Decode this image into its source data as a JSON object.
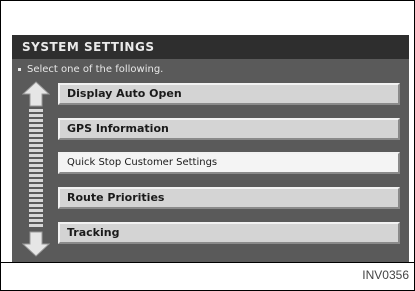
{
  "screen": {
    "title": "SYSTEM SETTINGS",
    "instruction": "Select one of the following.",
    "menu_items": [
      {
        "label": "Display Auto Open",
        "selected": false
      },
      {
        "label": "GPS Information",
        "selected": false
      },
      {
        "label": "Quick Stop Customer Settings",
        "selected": true
      },
      {
        "label": "Route Priorities",
        "selected": false
      },
      {
        "label": "Tracking",
        "selected": false
      }
    ],
    "scroll_up_icon": "arrow-up-icon",
    "scroll_down_icon": "arrow-down-icon"
  },
  "caption": "INV0356",
  "colors": {
    "screen_bg": "#5a5a5a",
    "header_bg": "#2e2e2e",
    "item_bg": "#d4d4d4",
    "item_selected_bg": "#f4f4f4"
  }
}
